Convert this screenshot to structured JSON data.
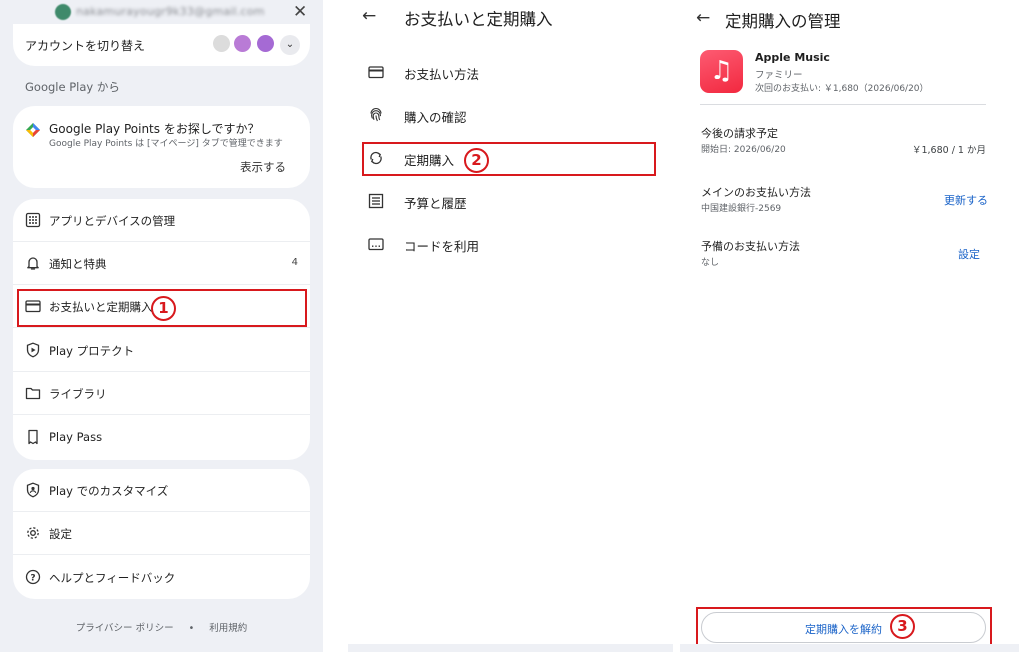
{
  "panel1": {
    "email": "nakamurayougr9k33@gmail.com",
    "switch_account": "アカウントを切り替え",
    "from_google_play": "Google Play から",
    "points_card": {
      "title": "Google Play Points をお探しですか？",
      "subtitle": "Google Play Points は [マイページ] タブで管理できます",
      "action": "表示する"
    },
    "menu": [
      {
        "label": "アプリとデバイスの管理",
        "icon": "grid-icon"
      },
      {
        "label": "通知と特典",
        "icon": "bell-icon",
        "badge": "4"
      },
      {
        "label": "お支払いと定期購入",
        "icon": "credit-card-icon"
      },
      {
        "label": "Play プロテクト",
        "icon": "shield-play-icon"
      },
      {
        "label": "ライブラリ",
        "icon": "folder-icon"
      },
      {
        "label": "Play Pass",
        "icon": "ticket-icon"
      }
    ],
    "menu2": [
      {
        "label": "Play でのカスタマイズ",
        "icon": "shield-person-icon"
      },
      {
        "label": "設定",
        "icon": "gear-icon"
      },
      {
        "label": "ヘルプとフィードバック",
        "icon": "help-icon"
      }
    ],
    "footer": {
      "privacy": "プライバシー ポリシー",
      "dot": "•",
      "terms": "利用規約"
    }
  },
  "panel2": {
    "title": "お支払いと定期購入",
    "items": [
      {
        "label": "お支払い方法",
        "icon": "credit-card-icon"
      },
      {
        "label": "購入の確認",
        "icon": "fingerprint-icon"
      },
      {
        "label": "定期購入",
        "icon": "sync-icon"
      },
      {
        "label": "予算と履歴",
        "icon": "list-icon"
      },
      {
        "label": "コードを利用",
        "icon": "code-card-icon"
      }
    ]
  },
  "panel3": {
    "title": "定期購入の管理",
    "app": {
      "name": "Apple Music",
      "plan": "ファミリー",
      "next_payment": "次回のお支払い: ￥1,680（2026/06/20）"
    },
    "upcoming": {
      "title": "今後の請求予定",
      "start": "開始日: 2026/06/20",
      "price": "￥1,680 / 1 か月"
    },
    "main_payment": {
      "title": "メインのお支払い方法",
      "value": "中国建設銀行-2569",
      "action": "更新する"
    },
    "backup_payment": {
      "title": "予備のお支払い方法",
      "value": "なし",
      "action": "設定"
    },
    "cancel_button": "定期購入を解約"
  },
  "annotations": {
    "step1": "1",
    "step2": "2",
    "step3": "3",
    "color": "#d8191d"
  },
  "colors": {
    "accent_blue": "#1a63c8",
    "panel_bg": "#eef0f5",
    "highlight_red": "#d8191d"
  }
}
